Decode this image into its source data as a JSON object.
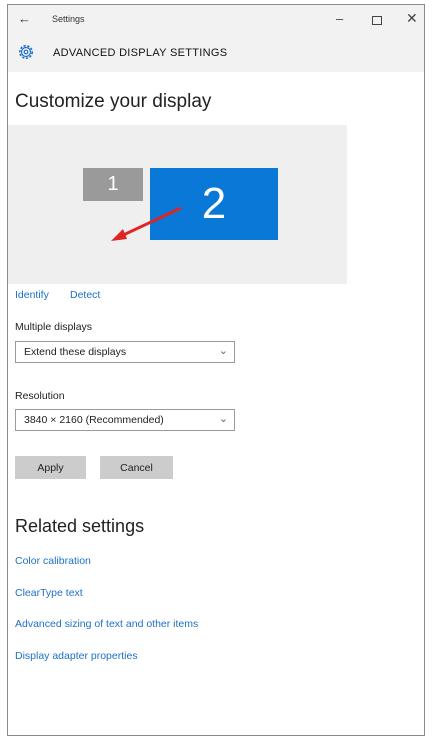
{
  "titlebar": {
    "back_glyph": "←",
    "title": "Settings",
    "minimize_glyph": "–",
    "close_glyph": "✕"
  },
  "header": {
    "title": "ADVANCED DISPLAY SETTINGS",
    "icon": "gear-icon"
  },
  "page_title": "Customize your display",
  "preview": {
    "monitor_1_label": "1",
    "monitor_2_label": "2",
    "selected_monitor": "2"
  },
  "links": {
    "identify": "Identify",
    "detect": "Detect"
  },
  "multiple_displays": {
    "label": "Multiple displays",
    "value": "Extend these displays"
  },
  "resolution": {
    "label": "Resolution",
    "value": "3840 × 2160 (Recommended)"
  },
  "buttons": {
    "apply": "Apply",
    "cancel": "Cancel"
  },
  "related": {
    "title": "Related settings",
    "items": [
      "Color calibration",
      "ClearType text",
      "Advanced sizing of text and other items",
      "Display adapter properties"
    ]
  },
  "colors": {
    "accent": "#0a78d7",
    "link": "#1e6fc9",
    "annotation_arrow": "#e02424"
  }
}
